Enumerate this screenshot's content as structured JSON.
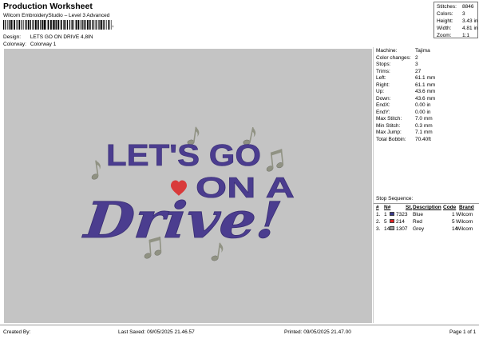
{
  "header": {
    "title": "Production Worksheet",
    "subtitle": "Wilcom EmbroideryStudio – Level 3 Advanced",
    "barcode_tail": ","
  },
  "meta": {
    "design_label": "Design:",
    "design_value": "LETS GO ON DRIVE 4,8IN",
    "colorway_label": "Colorway:",
    "colorway_value": "Colorway 1"
  },
  "summary": {
    "stitches_label": "Stitches:",
    "stitches_value": "8846",
    "colors_label": "Colors:",
    "colors_value": "3",
    "height_label": "Height:",
    "height_value": "3.43 in",
    "width_label": "Width:",
    "width_value": "4.81 in",
    "zoom_label": "Zoom:",
    "zoom_value": "1:1"
  },
  "design": {
    "line1": "LET'S GO",
    "line2": "ON A",
    "line3": "Drive!",
    "colors": {
      "text": "#4b3d8f",
      "heart": "#d93a3a",
      "notes": "#909283",
      "background": "#c4c4c4"
    }
  },
  "stats": [
    {
      "label": "Machine:",
      "value": "Tajima"
    },
    {
      "label": "Color changes:",
      "value": "2"
    },
    {
      "label": "Stops:",
      "value": "3"
    },
    {
      "label": "Trims:",
      "value": "27"
    },
    {
      "label": "Left:",
      "value": "61.1 mm"
    },
    {
      "label": "Right:",
      "value": "61.1 mm"
    },
    {
      "label": "Up:",
      "value": "43.6 mm"
    },
    {
      "label": "Down:",
      "value": "43.6 mm"
    },
    {
      "label": "EndX:",
      "value": "0.00 in"
    },
    {
      "label": "EndY:",
      "value": "0.00 in"
    },
    {
      "label": "Max Stitch:",
      "value": "7.0 mm"
    },
    {
      "label": "Min Stitch:",
      "value": "0.3 mm"
    },
    {
      "label": "Max Jump:",
      "value": "7.1 mm"
    },
    {
      "label": "Total Bobbin:",
      "value": "70.40ft"
    }
  ],
  "sequence": {
    "title": "Stop Sequence:",
    "headers": {
      "num": "#",
      "n": "N#",
      "st": "St.",
      "desc": "Description",
      "code": "Code",
      "brand": "Brand"
    },
    "rows": [
      {
        "num": "1.",
        "n": "1",
        "st": "7323",
        "desc": "Blue",
        "code": "1",
        "brand": "Wilcom",
        "color": "#3a3a8c"
      },
      {
        "num": "2.",
        "n": "5",
        "st": "214",
        "desc": "Red",
        "code": "5",
        "brand": "Wilcom",
        "color": "#e02020"
      },
      {
        "num": "3.",
        "n": "14",
        "st": "1307",
        "desc": "Grey",
        "code": "14",
        "brand": "Wilcom",
        "color": "#a0a0a0"
      }
    ]
  },
  "footer": {
    "created_by": "Created By:",
    "last_saved": "Last Saved: 09/05/2025 21.46.57",
    "printed": "Printed: 09/05/2025 21.47.00",
    "page": "Page 1 of 1"
  }
}
